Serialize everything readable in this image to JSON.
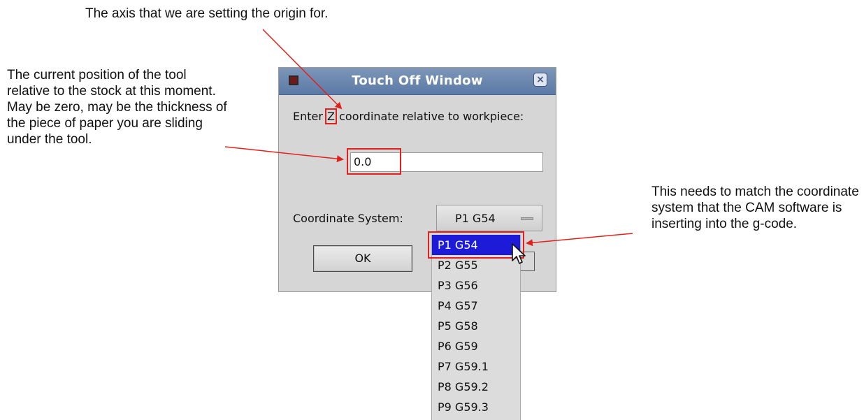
{
  "annotations": {
    "axis_note": "The axis that we are setting the origin for.",
    "position_note": "The current position of the tool relative to the stock at this moment. May be zero, may be the thickness of the piece of paper you are sliding under the tool.",
    "coordinate_note": "This needs to match the coordinate system that the CAM software is inserting into the g-code."
  },
  "window": {
    "title": "Touch Off Window",
    "close_glyph": "×",
    "prompt_before": "Enter",
    "axis": "Z",
    "prompt_after": "coordinate relative to workpiece:",
    "value": "0.0",
    "coord_label": "Coordinate System:",
    "coord_selected": "P1 G54",
    "ok_label": "OK"
  },
  "dropdown": {
    "options": [
      "P1 G54",
      "P2 G55",
      "P3 G56",
      "P4 G57",
      "P5 G58",
      "P6 G59",
      "P7 G59.1",
      "P8 G59.2",
      "P9 G59.3"
    ]
  },
  "colors": {
    "accent": "#e0211d",
    "selection": "#1d1bd8",
    "titlebar": "#6b88b0"
  }
}
